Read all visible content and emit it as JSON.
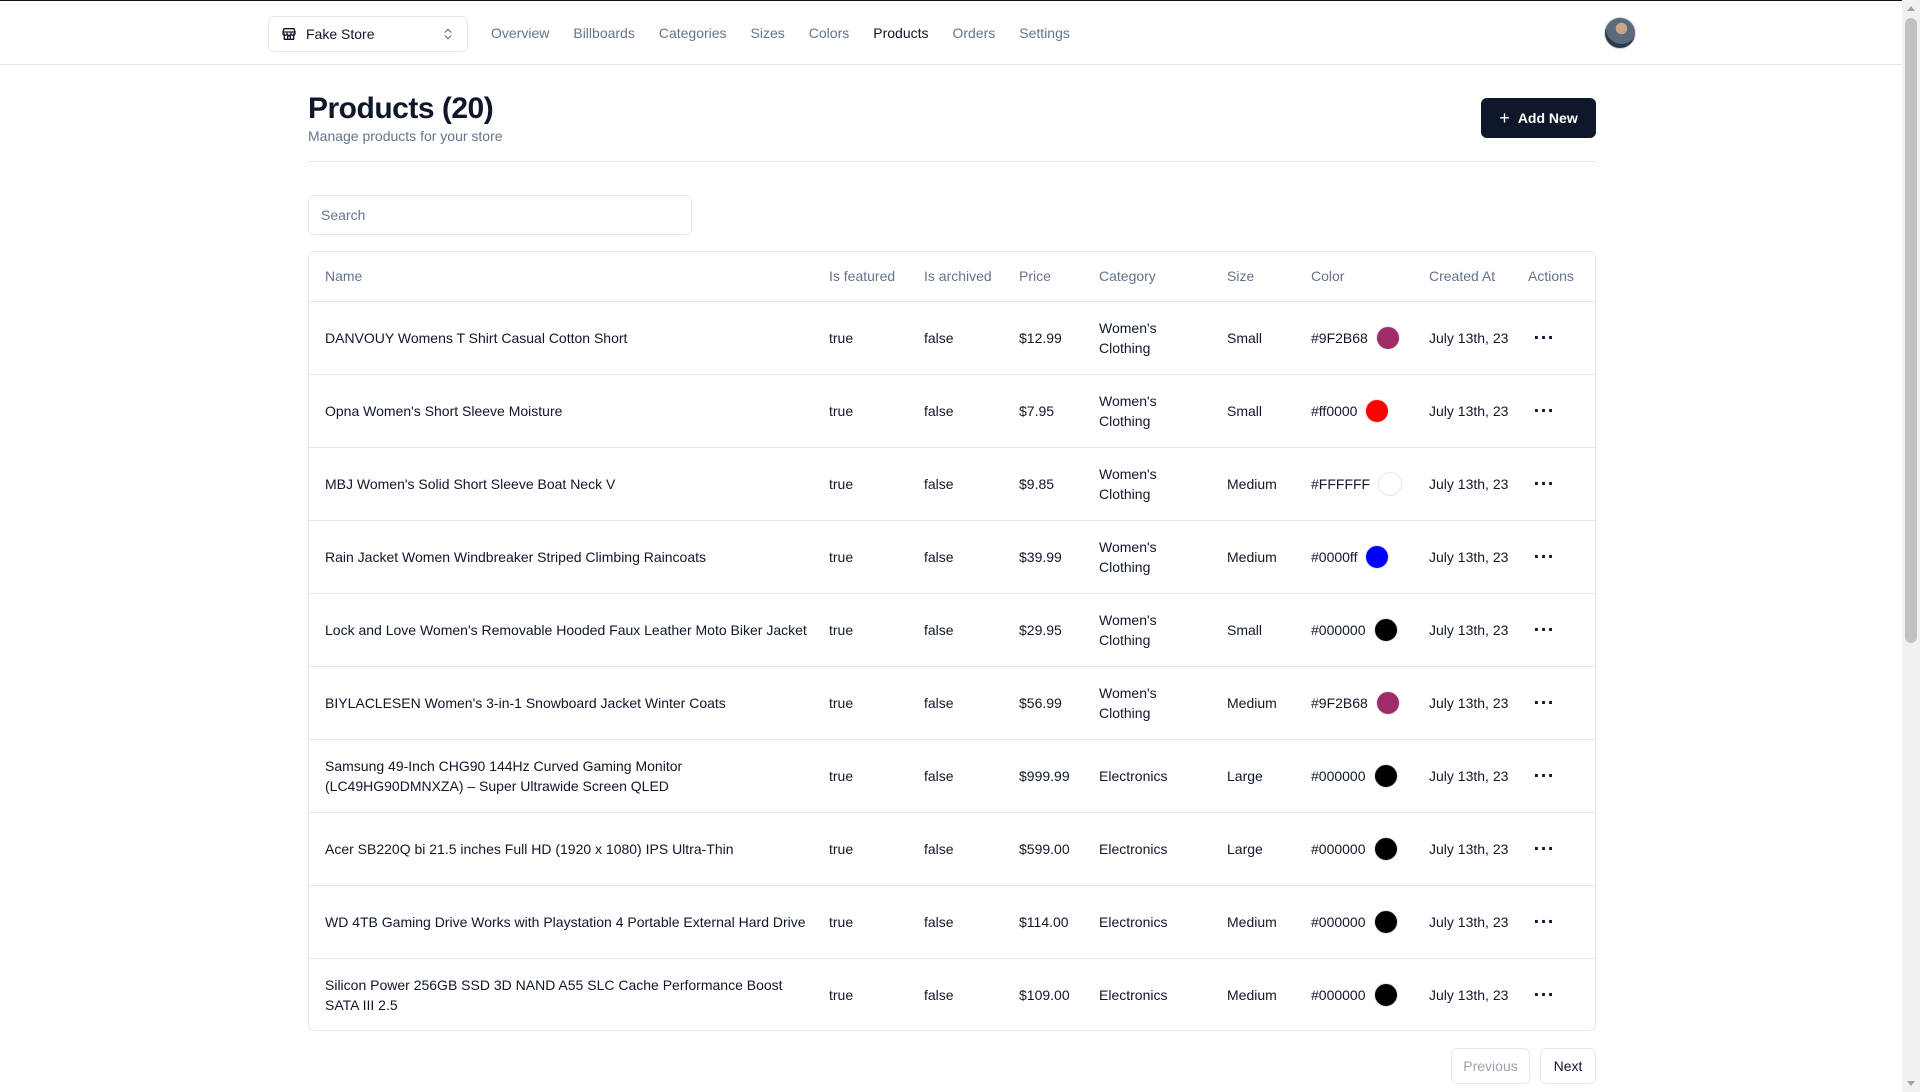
{
  "navbar": {
    "store_name": "Fake Store",
    "links": [
      "Overview",
      "Billboards",
      "Categories",
      "Sizes",
      "Colors",
      "Products",
      "Orders",
      "Settings"
    ],
    "active": "Products"
  },
  "header": {
    "title": "Products (20)",
    "subtitle": "Manage products for your store",
    "add_button": "Add New"
  },
  "search": {
    "placeholder": "Search",
    "value": ""
  },
  "table": {
    "columns": {
      "name": "Name",
      "featured": "Is featured",
      "archived": "Is archived",
      "price": "Price",
      "category": "Category",
      "size": "Size",
      "color": "Color",
      "created": "Created At",
      "actions": "Actions"
    },
    "rows": [
      {
        "name": "DANVOUY Womens T Shirt Casual Cotton Short",
        "featured": "true",
        "archived": "false",
        "price": "$12.99",
        "category": "Women's Clothing",
        "size": "Small",
        "color": "#9F2B68",
        "created": "July 13th, 23"
      },
      {
        "name": "Opna Women's Short Sleeve Moisture",
        "featured": "true",
        "archived": "false",
        "price": "$7.95",
        "category": "Women's Clothing",
        "size": "Small",
        "color": "#ff0000",
        "created": "July 13th, 23"
      },
      {
        "name": "MBJ Women's Solid Short Sleeve Boat Neck V",
        "featured": "true",
        "archived": "false",
        "price": "$9.85",
        "category": "Women's Clothing",
        "size": "Medium",
        "color": "#FFFFFF",
        "created": "July 13th, 23"
      },
      {
        "name": "Rain Jacket Women Windbreaker Striped Climbing Raincoats",
        "featured": "true",
        "archived": "false",
        "price": "$39.99",
        "category": "Women's Clothing",
        "size": "Medium",
        "color": "#0000ff",
        "created": "July 13th, 23"
      },
      {
        "name": "Lock and Love Women's Removable Hooded Faux Leather Moto Biker Jacket",
        "featured": "true",
        "archived": "false",
        "price": "$29.95",
        "category": "Women's Clothing",
        "size": "Small",
        "color": "#000000",
        "created": "July 13th, 23"
      },
      {
        "name": "BIYLACLESEN Women's 3-in-1 Snowboard Jacket Winter Coats",
        "featured": "true",
        "archived": "false",
        "price": "$56.99",
        "category": "Women's Clothing",
        "size": "Medium",
        "color": "#9F2B68",
        "created": "July 13th, 23"
      },
      {
        "name": "Samsung 49-Inch CHG90 144Hz Curved Gaming Monitor (LC49HG90DMNXZA) – Super Ultrawide Screen QLED",
        "featured": "true",
        "archived": "false",
        "price": "$999.99",
        "category": "Electronics",
        "size": "Large",
        "color": "#000000",
        "created": "July 13th, 23"
      },
      {
        "name": "Acer SB220Q bi 21.5 inches Full HD (1920 x 1080) IPS Ultra-Thin",
        "featured": "true",
        "archived": "false",
        "price": "$599.00",
        "category": "Electronics",
        "size": "Large",
        "color": "#000000",
        "created": "July 13th, 23"
      },
      {
        "name": "WD 4TB Gaming Drive Works with Playstation 4 Portable External Hard Drive",
        "featured": "true",
        "archived": "false",
        "price": "$114.00",
        "category": "Electronics",
        "size": "Medium",
        "color": "#000000",
        "created": "July 13th, 23"
      },
      {
        "name": "Silicon Power 256GB SSD 3D NAND A55 SLC Cache Performance Boost SATA III 2.5",
        "featured": "true",
        "archived": "false",
        "price": "$109.00",
        "category": "Electronics",
        "size": "Medium",
        "color": "#000000",
        "created": "July 13th, 23"
      }
    ],
    "actions_icon": "more-horizontal-icon"
  },
  "pagination": {
    "previous": "Previous",
    "next": "Next",
    "previous_disabled": true
  },
  "colors": {
    "primary": "#0f172a",
    "muted": "#64748b",
    "border": "#e5e7eb"
  }
}
